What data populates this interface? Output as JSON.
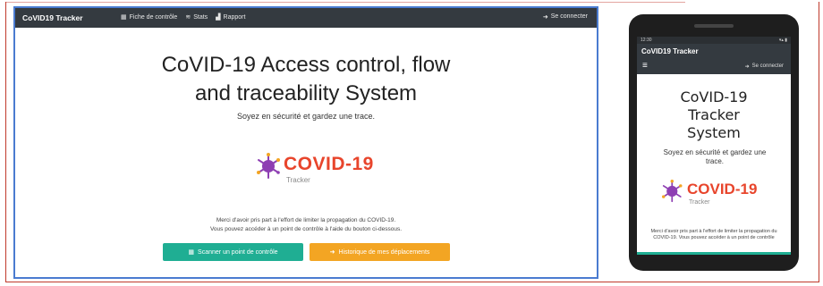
{
  "desktop": {
    "navbar": {
      "brand": "CoVID19 Tracker",
      "links": [
        {
          "icon": "id-card-icon",
          "glyph": "▦",
          "label": "Fiche de contrôle"
        },
        {
          "icon": "stats-icon",
          "glyph": "≋",
          "label": "Stats"
        },
        {
          "icon": "report-icon",
          "glyph": "▟",
          "label": "Rapport"
        }
      ],
      "login_icon_glyph": "➜",
      "login_label": "Se connecter"
    },
    "hero": {
      "title_line1": "CoVID-19 Access control, flow",
      "title_line2": "and traceability System",
      "subtitle": "Soyez en sécurité et gardez une trace."
    },
    "logo": {
      "text": "COVID-19",
      "sub": "Tracker"
    },
    "info_line1": "Merci d'avoir pris part à l'effort de limiter la propagation du COVID-19.",
    "info_line2": "Vous pouvez accéder à un point de contrôle à l'aide du bouton ci-dessous.",
    "buttons": {
      "primary": {
        "icon_glyph": "▦",
        "label": "Scanner un point de contrôle"
      },
      "secondary": {
        "icon_glyph": "➜",
        "label": "Historique de mes déplacements"
      }
    },
    "colors": {
      "navbar": "#343a40",
      "green": "#1fae93",
      "orange": "#f3a523",
      "logo": "#e8452c"
    }
  },
  "phone": {
    "status_left": "12:30",
    "status_right": "▾▴ ▮",
    "brand": "CoVID19 Tracker",
    "menu_glyph": "≡",
    "login_icon_glyph": "➜",
    "login_label": "Se connecter",
    "title_line1": "CoVID-19",
    "title_line2": "Tracker",
    "title_line3": "System",
    "subtitle": "Soyez en sécurité et gardez une trace.",
    "logo": {
      "text": "COVID-19",
      "sub": "Tracker"
    },
    "info": "Merci d'avoir pris part à l'effort de limiter la propagation du COVID-19. Vous pouvez accéder à un point de contrôle"
  }
}
